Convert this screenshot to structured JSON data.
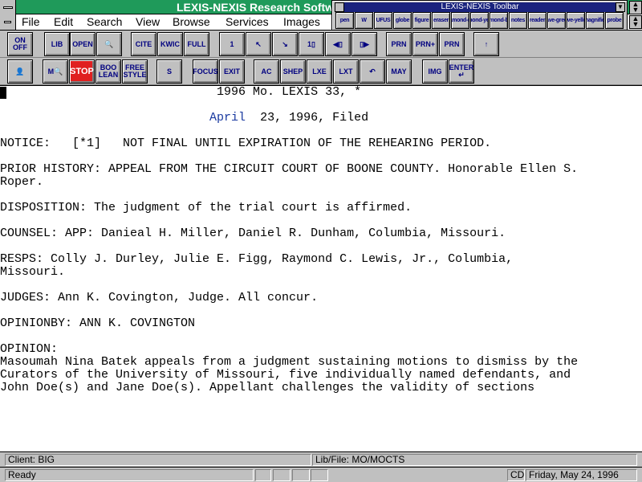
{
  "window": {
    "title": "LEXIS-NEXIS Research Softw"
  },
  "menu": [
    "File",
    "Edit",
    "Search",
    "View",
    "Browse",
    "Services",
    "Images"
  ],
  "toolbar1": [
    {
      "name": "on-off",
      "label": "ON OFF"
    },
    {
      "name": "library",
      "label": "LIB"
    },
    {
      "name": "open-folder",
      "label": "OPEN"
    },
    {
      "name": "search",
      "label": "🔍"
    },
    {
      "name": "cite",
      "label": "CITE"
    },
    {
      "name": "kwic",
      "label": "KWIC"
    },
    {
      "name": "full",
      "label": "FULL"
    },
    {
      "name": "first-page",
      "label": "1"
    },
    {
      "name": "prev-doc",
      "label": "↖"
    },
    {
      "name": "next-doc",
      "label": "↘"
    },
    {
      "name": "first-doc",
      "label": "1▯"
    },
    {
      "name": "prev-page",
      "label": "◀▯"
    },
    {
      "name": "next-page",
      "label": "▯▶"
    },
    {
      "name": "print",
      "label": "PRN"
    },
    {
      "name": "print-all",
      "label": "PRN+"
    },
    {
      "name": "print-disabled",
      "label": "PRN"
    },
    {
      "name": "top",
      "label": "↑"
    }
  ],
  "toolbar2": [
    {
      "name": "users",
      "label": "👤"
    },
    {
      "name": "modify",
      "label": "M🔍"
    },
    {
      "name": "stop",
      "label": "STOP"
    },
    {
      "name": "boolean",
      "label": "BOO LEAN"
    },
    {
      "name": "freestyle",
      "label": "FREE STYLE"
    },
    {
      "name": "shepard-kwic",
      "label": "S"
    },
    {
      "name": "focus",
      "label": "FOCUS"
    },
    {
      "name": "exit-focus",
      "label": "EXIT"
    },
    {
      "name": "autocite",
      "label": "AC"
    },
    {
      "name": "shepards",
      "label": "SHEP"
    },
    {
      "name": "lexcite",
      "label": "LXE"
    },
    {
      "name": "lxt",
      "label": "LXT"
    },
    {
      "name": "undo",
      "label": "↶"
    },
    {
      "name": "calendar",
      "label": "MAY"
    },
    {
      "name": "image",
      "label": "IMG"
    },
    {
      "name": "enter",
      "label": "ENTER ↵"
    }
  ],
  "floating_toolbar": {
    "title": "LEXIS-NEXIS Toolbar",
    "buttons": [
      "pen",
      "W",
      "UFUS",
      "globe",
      "figure",
      "eraser",
      "diamond-red",
      "diamond-yellow",
      "diamond-blue",
      "notes",
      "reader",
      "save-green",
      "save-yellow",
      "magnifier",
      "probe"
    ]
  },
  "document": {
    "cite": "1996 Mo. LEXIS 33, *",
    "date_month": "April",
    "date_rest": "  23, 1996, Filed",
    "lines": [
      "NOTICE:   [*1]   NOT FINAL UNTIL EXPIRATION OF THE REHEARING PERIOD.",
      "",
      "PRIOR HISTORY: APPEAL FROM THE CIRCUIT COURT OF BOONE COUNTY. Honorable Ellen S.",
      "Roper.",
      "",
      "DISPOSITION: The judgment of the trial court is affirmed.",
      "",
      "COUNSEL: APP: Danieal H. Miller, Daniel R. Dunham, Columbia, Missouri.",
      "",
      "RESPS: Colly J. Durley, Julie E. Figg, Raymond C. Lewis, Jr., Columbia,",
      "Missouri.",
      "",
      "JUDGES: Ann K. Covington, Judge. All concur.",
      "",
      "OPINIONBY: ANN K. COVINGTON",
      "",
      "OPINION:",
      "Masoumah Nina Batek appeals from a judgment sustaining motions to dismiss by the",
      "Curators of the University of Missouri, five individually named defendants, and",
      "John Doe(s) and Jane Doe(s). Appellant challenges the validity of sections"
    ]
  },
  "status": {
    "client": "Client: BIG",
    "libfile": "Lib/File: MO/MOCTS",
    "state": "Ready",
    "cd": "CD",
    "date": "Friday, May 24, 1996"
  },
  "colors": {
    "title_bar": "#1f9a5a",
    "toolbar_title": "#1a237e",
    "date_month": "#1a3aa0"
  }
}
